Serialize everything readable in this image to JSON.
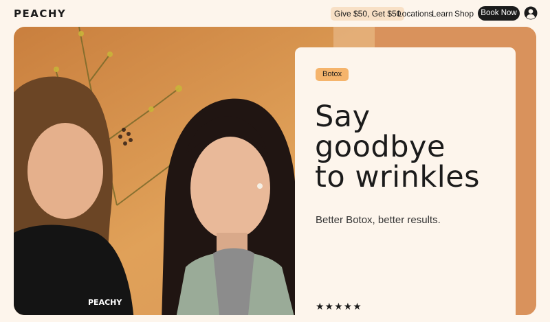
{
  "nav": {
    "logo": "PEACHY",
    "promo": "Give $50, Get $50",
    "links": [
      "Locations",
      "Learn",
      "Shop"
    ],
    "book_button": "Book Now",
    "account_icon": "user-circle-icon"
  },
  "hero": {
    "shirt_text": "PEACHY",
    "tag": "Botox",
    "headline": "Say\ngoodbye\nto wrinkles",
    "subheadline": "Better Botox, better results.",
    "stars": "★★★★★"
  },
  "colors": {
    "background": "#fdf5ec",
    "accent_peach": "#f5b46c",
    "promo_bg": "#f8e0c6",
    "dark": "#1b1b1b"
  }
}
